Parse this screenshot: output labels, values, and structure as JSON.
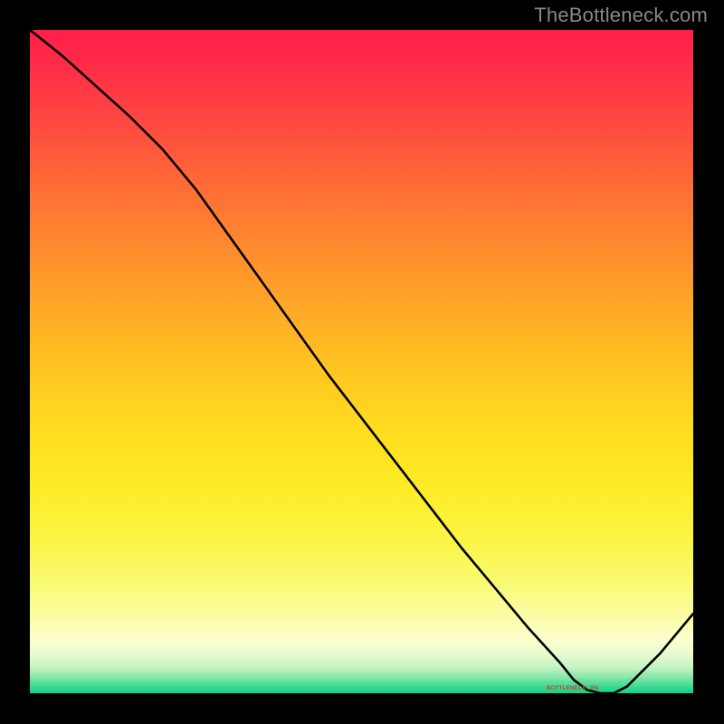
{
  "attribution": "TheBottleneck.com",
  "chart_data": {
    "type": "line",
    "title": "",
    "xlabel": "",
    "ylabel": "",
    "xlim": [
      0,
      100
    ],
    "ylim": [
      0,
      100
    ],
    "series": [
      {
        "name": "curve",
        "x": [
          0,
          5,
          10,
          15,
          20,
          25,
          30,
          35,
          40,
          45,
          50,
          55,
          60,
          65,
          70,
          75,
          80,
          82,
          84,
          86,
          88,
          90,
          95,
          100
        ],
        "y": [
          100,
          96,
          91.5,
          87,
          82,
          76,
          69,
          62,
          55,
          48,
          41.5,
          35,
          28.5,
          22,
          16,
          10,
          4.5,
          2,
          0.5,
          0,
          0,
          1,
          6,
          12
        ]
      }
    ],
    "annotations": [
      {
        "text": "BOTTLENECK: 0%",
        "x": 82,
        "y": 0
      }
    ]
  },
  "colors": {
    "curve": "#000000",
    "label": "#d43a2a"
  }
}
